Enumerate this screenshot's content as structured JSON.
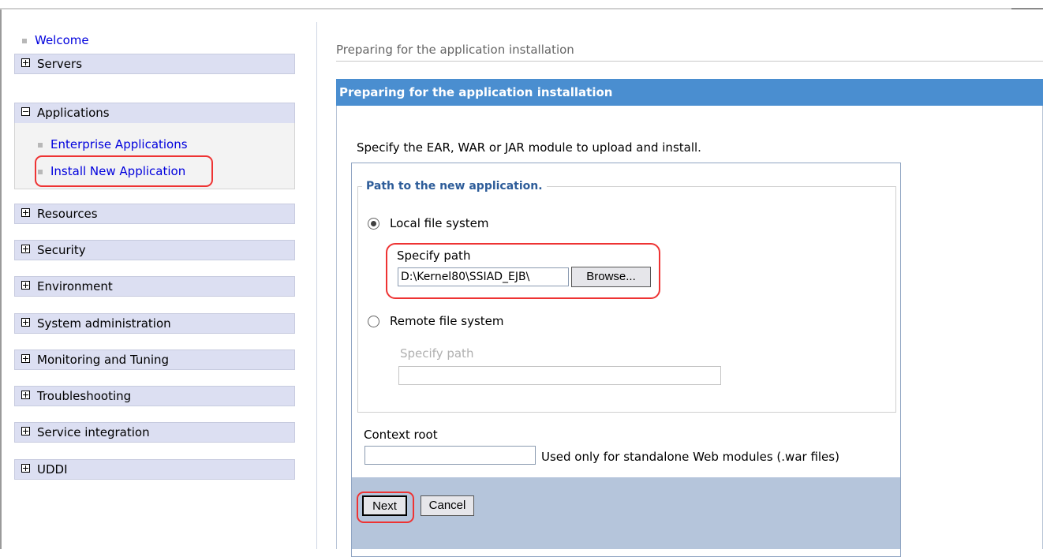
{
  "nav": {
    "welcome": "Welcome",
    "servers": "Servers",
    "applications": "Applications",
    "sub_items": [
      "Enterprise Applications",
      "Install New Application"
    ],
    "items_after": [
      "Resources",
      "Security",
      "Environment",
      "System administration",
      "Monitoring and Tuning",
      "Troubleshooting",
      "Service integration",
      "UDDI"
    ]
  },
  "main": {
    "breadcrumb": "Preparing for the application installation",
    "panel_title": "Preparing for the application installation",
    "intro": "Specify the EAR, WAR or JAR module to upload and install.",
    "legend": "Path to the new application.",
    "local": {
      "label": "Local file system",
      "path_label": "Specify path",
      "path_value": "D:\\Kernel80\\SSIAD_EJB\\",
      "browse": "Browse..."
    },
    "remote": {
      "label": "Remote file system",
      "path_label": "Specify path",
      "path_value": ""
    },
    "context_root": {
      "label": "Context root",
      "value": "",
      "hint": "Used only for standalone Web modules (.war files)"
    },
    "buttons": {
      "next": "Next",
      "cancel": "Cancel"
    }
  },
  "colors": {
    "panel_header": "#4a8ed0",
    "nav_item_bg": "#dcdff2",
    "callout": "#ee3333",
    "footer_bar": "#b5c5db",
    "link": "#0000dd"
  }
}
